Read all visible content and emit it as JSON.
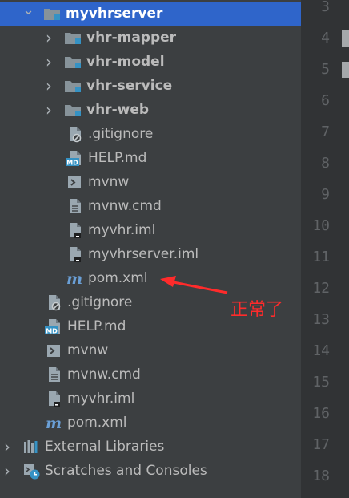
{
  "tree": {
    "items": [
      {
        "label": "myvhrserver",
        "indent": 26,
        "arrow": "down",
        "icon": "module-folder",
        "bold": true,
        "selected": true
      },
      {
        "label": "vhr-mapper",
        "indent": 52,
        "arrow": "right",
        "icon": "module-folder",
        "bold": true
      },
      {
        "label": "vhr-model",
        "indent": 52,
        "arrow": "right",
        "icon": "module-folder",
        "bold": true
      },
      {
        "label": "vhr-service",
        "indent": 52,
        "arrow": "right",
        "icon": "module-folder",
        "bold": true
      },
      {
        "label": "vhr-web",
        "indent": 52,
        "arrow": "right",
        "icon": "module-folder",
        "bold": true
      },
      {
        "label": ".gitignore",
        "indent": 80,
        "icon": "ignore-file"
      },
      {
        "label": "HELP.md",
        "indent": 80,
        "icon": "markdown-file",
        "icon_text": "MD"
      },
      {
        "label": "mvnw",
        "indent": 80,
        "icon": "shell-file"
      },
      {
        "label": "mvnw.cmd",
        "indent": 80,
        "icon": "text-file"
      },
      {
        "label": "myvhr.iml",
        "indent": 80,
        "icon": "iml-file"
      },
      {
        "label": "myvhrserver.iml",
        "indent": 80,
        "icon": "iml-file"
      },
      {
        "label": "pom.xml",
        "indent": 80,
        "icon": "maven-file",
        "icon_text": "m"
      },
      {
        "label": ".gitignore",
        "indent": 54,
        "icon": "ignore-file"
      },
      {
        "label": "HELP.md",
        "indent": 54,
        "icon": "markdown-file",
        "icon_text": "MD"
      },
      {
        "label": "mvnw",
        "indent": 54,
        "icon": "shell-file"
      },
      {
        "label": "mvnw.cmd",
        "indent": 54,
        "icon": "text-file"
      },
      {
        "label": "myvhr.iml",
        "indent": 54,
        "icon": "iml-file"
      },
      {
        "label": "pom.xml",
        "indent": 54,
        "icon": "maven-file",
        "icon_text": "m"
      },
      {
        "label": "External Libraries",
        "indent": 0,
        "arrow": "right",
        "icon": "libraries"
      },
      {
        "label": "Scratches and Consoles",
        "indent": 0,
        "arrow": "right",
        "icon": "scratches"
      }
    ]
  },
  "gutter": {
    "line_numbers": [
      "3",
      "4",
      "5",
      "6",
      "7",
      "8",
      "9",
      "10",
      "11",
      "12",
      "13",
      "14",
      "15",
      "16",
      "17",
      "18"
    ]
  },
  "annotation": {
    "text": "正常了",
    "color": "#ff2b2b"
  },
  "colors": {
    "panel_bg": "#3c3f41",
    "selected_bg": "#2f65ca",
    "folder_icon": "#87939a",
    "module_dot": "#3592c4",
    "maven_icon": "#6a9fd6"
  }
}
